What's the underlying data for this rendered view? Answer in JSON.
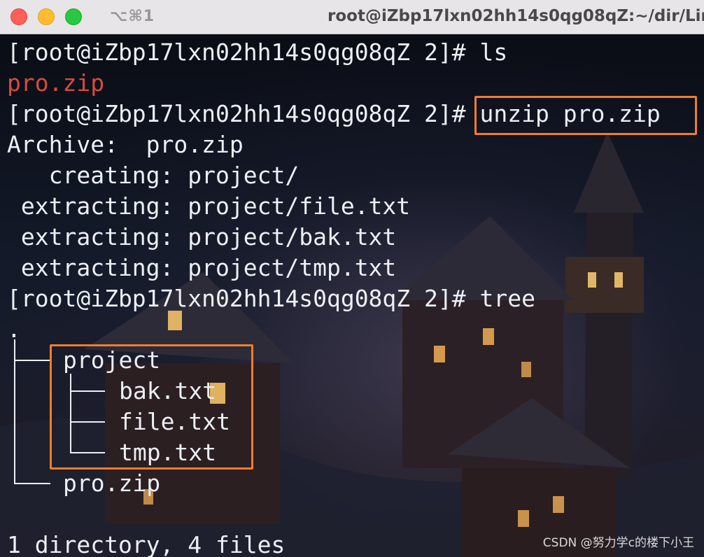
{
  "window": {
    "shortcut": "⌥⌘1",
    "title": "root@iZbp17lxn02hh14s0qg08qZ:~/dir/Lin"
  },
  "terminal": {
    "lines": [
      {
        "prompt": "[root@iZbp17lxn02hh14s0qg08qZ 2]# ",
        "cmd": "ls"
      },
      {
        "out": "pro.zip"
      },
      {
        "prompt": "[root@iZbp17lxn02hh14s0qg08qZ 2]#",
        "cmd": " unzip pro.zip"
      },
      {
        "out": "Archive:  pro.zip"
      },
      {
        "out": "   creating: project/"
      },
      {
        "out": " extracting: project/file.txt"
      },
      {
        "out": " extracting: project/bak.txt"
      },
      {
        "out": " extracting: project/tmp.txt"
      },
      {
        "prompt": "[root@iZbp17lxn02hh14s0qg08qZ 2]# ",
        "cmd": "tree"
      },
      {
        "out": "."
      },
      {
        "out": "project"
      },
      {
        "out": "bak.txt"
      },
      {
        "out": "file.txt"
      },
      {
        "out": "tmp.txt"
      },
      {
        "out": "pro.zip"
      },
      {
        "out": "1 directory, 4 files"
      }
    ]
  },
  "watermark": "CSDN @努力学c的楼下小王",
  "colors": {
    "text": "#eceff4",
    "zip_file": "#d94b3c",
    "highlight_box": "#ef7d2e"
  }
}
